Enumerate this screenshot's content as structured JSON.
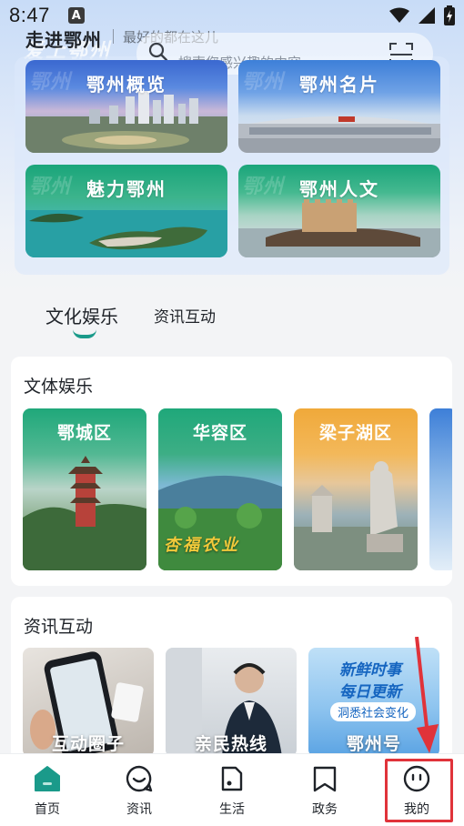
{
  "status_bar": {
    "time": "8:47",
    "notif_letter": "A"
  },
  "header": {
    "title": "走进鄂州",
    "watermark": "爱上鄂州",
    "subtitle": "最好的都在这儿",
    "search_placeholder": "搜索您感兴趣的内容"
  },
  "top_tiles": [
    {
      "label": "鄂州概览",
      "watermark": "鄂州"
    },
    {
      "label": "鄂州名片",
      "watermark": "鄂州"
    },
    {
      "label": "魅力鄂州",
      "watermark": "鄂州"
    },
    {
      "label": "鄂州人文",
      "watermark": "鄂州"
    }
  ],
  "tabs": {
    "active": "文化娱乐",
    "inactive": "资讯互动"
  },
  "culture_section": {
    "title": "文体娱乐",
    "districts": [
      {
        "label": "鄂城区"
      },
      {
        "label": "华容区",
        "sign": "杏福农业"
      },
      {
        "label": "梁子湖区"
      }
    ]
  },
  "news_section": {
    "title": "资讯互动",
    "cards": [
      {
        "label": "互动圈子"
      },
      {
        "label": "亲民热线"
      },
      {
        "label": "鄂州号",
        "headline1": "新鲜时事",
        "headline2": "每日更新",
        "tag": "洞悉社会变化"
      }
    ]
  },
  "bottom_nav": [
    {
      "label": "首页",
      "icon": "home-icon"
    },
    {
      "label": "资讯",
      "icon": "chat-bubble-icon"
    },
    {
      "label": "生活",
      "icon": "life-card-icon"
    },
    {
      "label": "政务",
      "icon": "bookmark-icon"
    },
    {
      "label": "我的",
      "icon": "profile-face-icon"
    }
  ],
  "colors": {
    "accent": "#1a9a8a",
    "highlight": "#e0333a",
    "tile_blue": "#3d7fd8",
    "tile_green": "#1fa87a",
    "tile_orange": "#f0a93a"
  }
}
